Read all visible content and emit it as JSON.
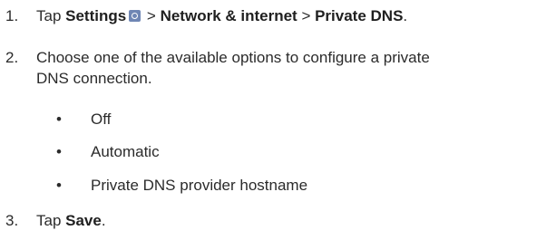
{
  "steps": [
    {
      "number": "1.",
      "prefix": "Tap ",
      "settings": "Settings",
      "icon": "settings-icon",
      "sep1": " > ",
      "network": "Network & internet",
      "sep2": " > ",
      "private_dns": "Private DNS",
      "suffix": "."
    },
    {
      "number": "2.",
      "line1": "Choose one of the available options to configure a private",
      "line2": "DNS connection."
    },
    {
      "number": "3.",
      "prefix": "Tap ",
      "save": "Save",
      "suffix": "."
    }
  ],
  "options": [
    {
      "bullet": "•",
      "label": "Off"
    },
    {
      "bullet": "•",
      "label": "Automatic"
    },
    {
      "bullet": "•",
      "label": "Private DNS provider hostname"
    }
  ]
}
